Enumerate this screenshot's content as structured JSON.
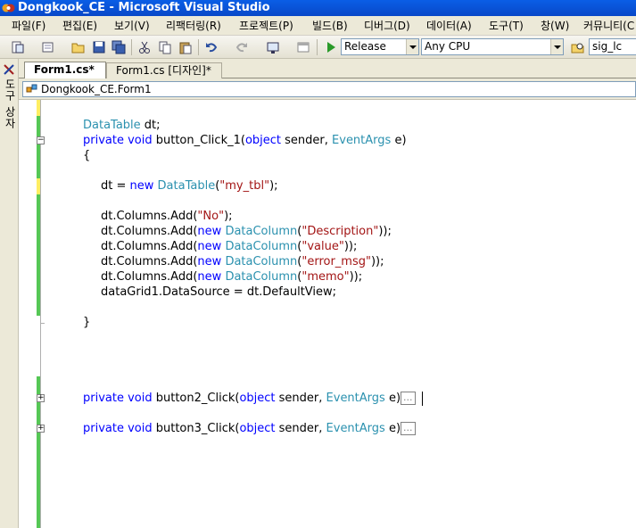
{
  "window": {
    "title": "Dongkook_CE - Microsoft Visual Studio"
  },
  "menu": [
    "파일(F)",
    "편집(E)",
    "보기(V)",
    "리팩터링(R)",
    "프로젝트(P)",
    "빌드(B)",
    "디버그(D)",
    "데이터(A)",
    "도구(T)",
    "창(W)",
    "커뮤니티(C"
  ],
  "toolbar": {
    "configuration": "Release",
    "platform": "Any CPU",
    "find_value": "sig_lc"
  },
  "toolbox": {
    "label": "도구 상자"
  },
  "tabs": [
    {
      "label": "Form1.cs*",
      "active": true
    },
    {
      "label": "Form1.cs [디자인]*",
      "active": false
    }
  ],
  "navigation": {
    "class": "Dongkook_CE.Form1"
  },
  "colors": {
    "keyword": "#0000ff",
    "type": "#2b91af",
    "string": "#a31515",
    "change_bar": "#ffee62",
    "saved_bar": "#55c755"
  },
  "code": {
    "l1_type": "DataTable",
    "l1_rest": " dt;",
    "l2_kw": "private void",
    "l2_name": " button_Click_1(",
    "l2_kw2": "object",
    "l2_mid": " sender, ",
    "l2_type": "EventArgs",
    "l2_end": " e)",
    "l3": "{",
    "l4_pre": "dt = ",
    "l4_kw": "new",
    "l4_sp": " ",
    "l4_type": "DataTable",
    "l4_open": "(",
    "l4_str": "\"my_tbl\"",
    "l4_end": ");",
    "l5_pre": "dt.Columns.Add(",
    "l5_str": "\"No\"",
    "l5_end": ");",
    "cols": [
      {
        "pre": "dt.Columns.Add(",
        "kw": "new",
        "type": "DataColumn",
        "open": "(",
        "str": "\"Description\"",
        "end": "));"
      },
      {
        "pre": "dt.Columns.Add(",
        "kw": "new",
        "type": "DataColumn",
        "open": "(",
        "str": "\"value\"",
        "end": "));"
      },
      {
        "pre": "dt.Columns.Add(",
        "kw": "new",
        "type": "DataColumn",
        "open": "(",
        "str": "\"error_msg\"",
        "end": "));"
      },
      {
        "pre": "dt.Columns.Add(",
        "kw": "new",
        "type": "DataColumn",
        "open": "(",
        "str": "\"memo\"",
        "end": "));"
      }
    ],
    "l10": "dataGrid1.DataSource = dt.DefaultView;",
    "l11": "}",
    "m2_name": " button2_Click(",
    "m3_name": " button3_Click(",
    "collapsed": "..."
  }
}
